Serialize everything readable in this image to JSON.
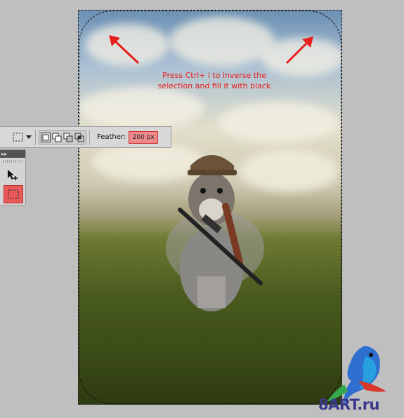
{
  "document": {
    "annotation_line1": "Press Ctrl+ i to inverse the",
    "annotation_line2": "selection and fill it with black"
  },
  "options_bar": {
    "feather_label": "Feather:",
    "feather_value": "200 px",
    "feather_highlight_color": "#ef8a8a"
  },
  "tools_panel": {
    "collapse_glyph": "▸▸",
    "tools": [
      {
        "name": "move-tool-icon"
      },
      {
        "name": "rectangular-marquee-tool-icon"
      }
    ],
    "active_tool_highlight": "#e85a5a"
  },
  "watermark": {
    "text": "8ART.ru"
  },
  "colors": {
    "annotation": "#e8201f",
    "arrow": "#e8201f"
  }
}
